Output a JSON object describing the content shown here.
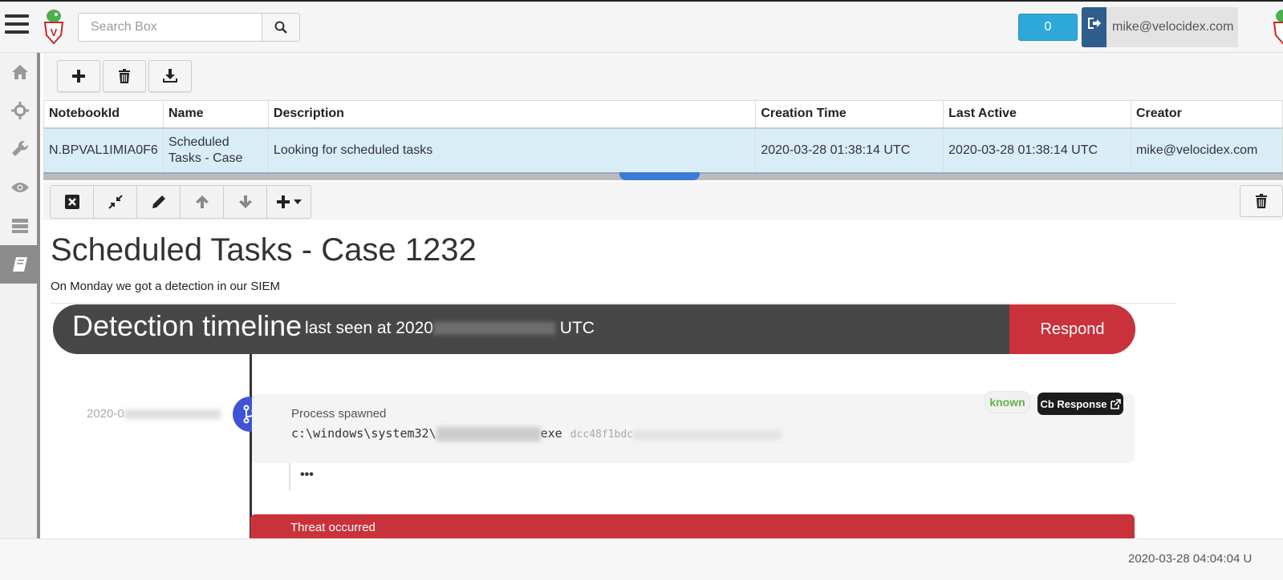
{
  "search": {
    "placeholder": "Search Box"
  },
  "header": {
    "count_label": "0",
    "username": "mike@velocidex.com"
  },
  "sidebar": {
    "items": [
      "home-icon",
      "crosshair-icon",
      "wrench-icon",
      "eye-icon",
      "server-icon",
      "book-icon"
    ]
  },
  "table": {
    "columns": [
      "NotebookId",
      "Name",
      "Description",
      "Creation Time",
      "Last Active",
      "Creator"
    ],
    "rows": [
      {
        "id": "N.BPVAL1IMIA0F6",
        "name": "Scheduled Tasks - Case 1232",
        "description": "Looking for scheduled tasks",
        "created": "2020-03-28 01:38:14 UTC",
        "last_active": "2020-03-28 01:38:14 UTC",
        "creator": "mike@velocidex.com"
      }
    ]
  },
  "cell": {
    "title": "Scheduled Tasks - Case 1232",
    "paragraph": "On Monday we got a detection in our SIEM"
  },
  "embed": {
    "header_title": "Detection timeline",
    "header_sub_prefix": "last seen at 2020",
    "header_sub_suffix": "UTC",
    "respond_label": "Respond",
    "left_timestamp": "2020-0",
    "event_label": "Process spawned",
    "path_prefix": "c:\\windows\\system32\\",
    "path_suffix": "exe",
    "hash_prefix": "dcc48f1bdc",
    "known_label": "known",
    "cb_label": "Cb Response",
    "dots": "•••",
    "threat_label": "Threat occurred"
  },
  "footer": {
    "time": "2020-03-28 04:04:04 U"
  },
  "colors": {
    "accent_blue": "#2ea8d8",
    "row_highlight": "#d9edf7",
    "respond_red": "#c9323b",
    "branch_blue": "#4053d6"
  }
}
